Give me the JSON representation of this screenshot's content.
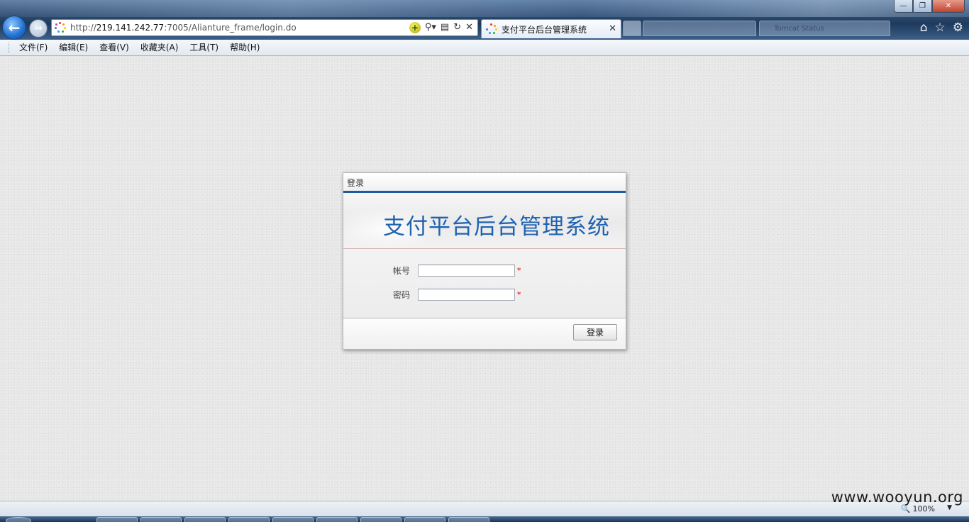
{
  "browser": {
    "url_prefix": "http://",
    "url_host": "219.141.242.77",
    "url_path": ":7005/Alianture_frame/login.do",
    "active_tab_title": "支付平台后台管理系统",
    "ghost_tabs": [
      "",
      "Tomcat Status"
    ],
    "window_buttons": {
      "min": "—",
      "max": "❐",
      "close": "✕"
    }
  },
  "menu": [
    "文件(F)",
    "编辑(E)",
    "查看(V)",
    "收藏夹(A)",
    "工具(T)",
    "帮助(H)"
  ],
  "login": {
    "header": "登录",
    "title": "支付平台后台管理系统",
    "account_label": "帐号",
    "account_value": "",
    "password_label": "密码",
    "password_value": "",
    "required_mark": "*",
    "submit_label": "登录"
  },
  "status": {
    "zoom": "100%"
  },
  "watermark": "www.wooyun.org",
  "icons": {
    "back": "arrow-left-icon",
    "forward": "arrow-right-icon",
    "home": "home-icon",
    "favorites": "star-icon",
    "tools": "gear-icon"
  }
}
